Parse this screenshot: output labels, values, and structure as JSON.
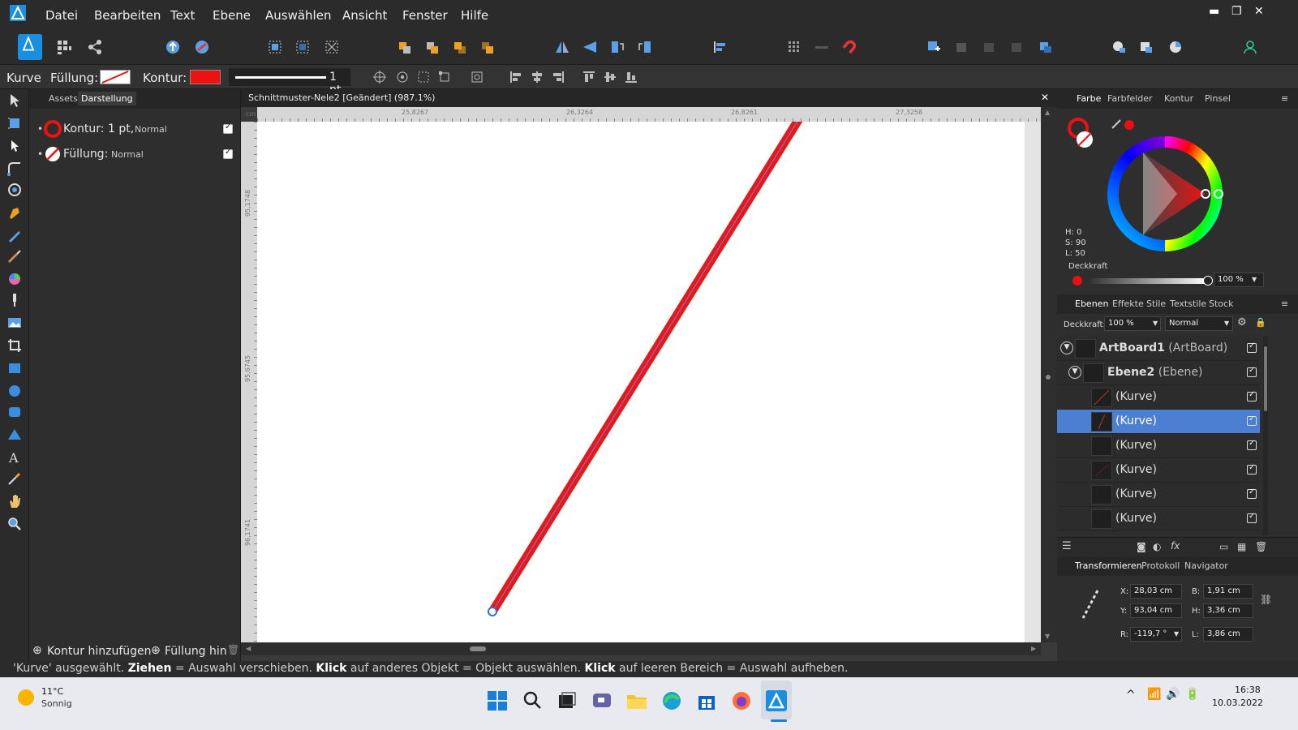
{
  "menu": {
    "items": [
      "Datei",
      "Bearbeiten",
      "Text",
      "Ebene",
      "Auswählen",
      "Ansicht",
      "Fenster",
      "Hilfe"
    ]
  },
  "context": {
    "tool_name": "Kurve",
    "fill_label": "Füllung:",
    "stroke_label": "Kontur:",
    "stroke_color": "#ee1111",
    "stroke_width": "1 pt"
  },
  "left_panel": {
    "tabs": [
      "Assets",
      "Darstellung"
    ],
    "rows": [
      {
        "label": "Kontur: 1 pt,",
        "mode": "Normal"
      },
      {
        "label": "Füllung:",
        "mode": "Normal"
      }
    ],
    "add_stroke": "Kontur hinzufügen",
    "add_fill": "Füllung hin"
  },
  "document": {
    "title": "Schnittmuster-Nele2 [Geändert] (987.1%)",
    "ruler_unit": "cm",
    "h_ticks": [
      "25,8267",
      "26,3264",
      "26,8261",
      "27,3258"
    ],
    "v_ticks": [
      "95,1748",
      "95,6745",
      "96,1741"
    ]
  },
  "color_panel": {
    "tabs": [
      "Farbe",
      "Farbfelder",
      "Kontur",
      "Pinsel"
    ],
    "h": "H: 0",
    "s": "S: 90",
    "l": "L: 50",
    "opacity_label": "Deckkraft",
    "opacity_value": "100 %",
    "accent": "#e81111"
  },
  "layers_panel": {
    "tabs": [
      "Ebenen",
      "Effekte",
      "Stile",
      "Textstile",
      "Stock"
    ],
    "opacity_label": "Deckkraft:",
    "opacity_value": "100 %",
    "blend_mode": "Normal",
    "artboard": {
      "name": "ArtBoard1",
      "type": "(ArtBoard)"
    },
    "layer": {
      "name": "Ebene2",
      "type": "(Ebene)"
    },
    "items": [
      "(Kurve)",
      "(Kurve)",
      "(Kurve)",
      "(Kurve)",
      "(Kurve)",
      "(Kurve)"
    ],
    "selected_index": 1
  },
  "transform_panel": {
    "tabs": [
      "Transformieren",
      "Protokoll",
      "Navigator"
    ],
    "x_label": "X:",
    "x": "28,03 cm",
    "y_label": "Y:",
    "y": "93,04 cm",
    "b_label": "B:",
    "b": "1,91 cm",
    "h_label": "H:",
    "h": "3,36 cm",
    "r_label": "R:",
    "r": "-119,7 °",
    "l_label": "L:",
    "l": "3,86 cm"
  },
  "status": {
    "p1": "'Kurve' ausgewählt. ",
    "b1": "Ziehen",
    "p2": " = Auswahl verschieben. ",
    "b2": "Klick",
    "p3": " auf anderes Objekt = Objekt auswählen. ",
    "b3": "Klick",
    "p4": " auf leeren Bereich = Auswahl aufheben."
  },
  "taskbar": {
    "temp": "11°C",
    "weather": "Sonnig",
    "time": "16:38",
    "date": "10.03.2022"
  }
}
